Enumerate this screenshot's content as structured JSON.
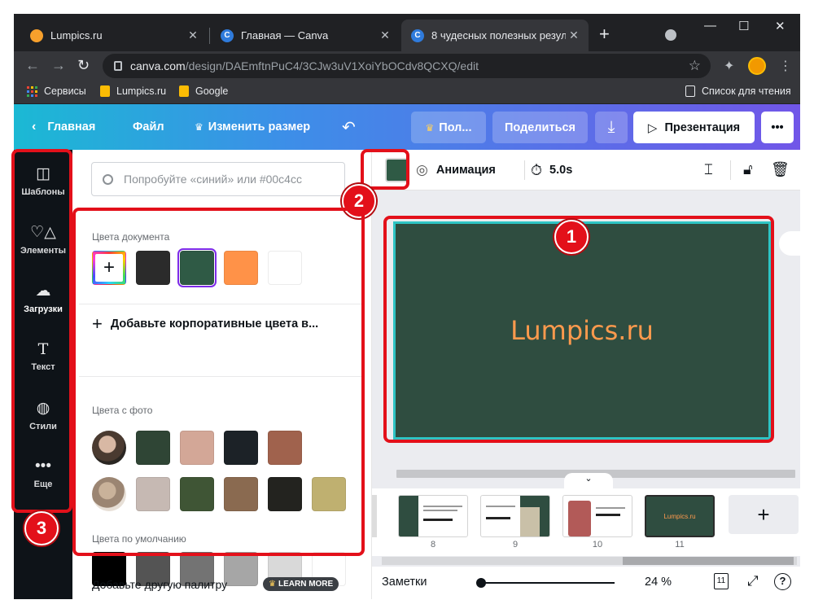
{
  "browser": {
    "tabs": [
      {
        "title": "Lumpics.ru",
        "favicon_color": "#f7a02c"
      },
      {
        "title": "Главная — Canva",
        "favicon_color": "#2f7bdc"
      },
      {
        "title": "8 чудесных полезных результа",
        "favicon_color": "#2f7bdc"
      }
    ],
    "url_host": "canva.com",
    "url_path": "/design/DAEmftnPuC4/3CJw3uV1XoiYbOCdv8QCXQ/edit",
    "bookmarks": {
      "apps": "Сервисы",
      "items": [
        "Lumpics.ru",
        "Google"
      ],
      "reading_list": "Список для чтения"
    }
  },
  "canva": {
    "header": {
      "home": "Главная",
      "file": "Файл",
      "resize": "Изменить размер",
      "upgrade": "Пол...",
      "share": "Поделиться",
      "present": "Презентация",
      "more": "•••"
    },
    "rail": [
      {
        "label": "Шаблоны",
        "icon": "templates-icon"
      },
      {
        "label": "Элементы",
        "icon": "elements-icon"
      },
      {
        "label": "Загрузки",
        "icon": "uploads-icon"
      },
      {
        "label": "Текст",
        "icon": "text-icon"
      },
      {
        "label": "Стили",
        "icon": "styles-icon"
      },
      {
        "label": "Еще",
        "icon": "more-icon"
      }
    ],
    "panel": {
      "search_placeholder": "Попробуйте «синий» или #00c4cc",
      "document_colors_label": "Цвета документа",
      "document_colors": [
        "#2b2b2b",
        "#2f5a45",
        "#ff9248",
        "#ffffff"
      ],
      "selected_color": "#2f5a45",
      "add_brand": "Добавьте корпоративные цвета в...",
      "photo_colors_label": "Цвета с фото",
      "photo_row_1": [
        "#2f4535",
        "#d3a797",
        "#1c2227",
        "#a0624d"
      ],
      "photo_row_2": [
        "#c6b9b3",
        "#3f5535",
        "#8a6a50",
        "#23231f",
        "#bfb070"
      ],
      "default_colors_label": "Цвета по умолчанию",
      "default_colors": [
        "#000000",
        "#545454",
        "#737373",
        "#a6a6a6",
        "#d9d9d9",
        "#ffffff"
      ],
      "footer_text": "Добавьте другую палитру",
      "learn_more": "LEARN MORE"
    },
    "toolbar": {
      "animation": "Анимация",
      "duration": "5.0s"
    },
    "slide": {
      "text": "Lumpics.ru",
      "background": "#2f4d40",
      "text_color": "#ff9a4d"
    },
    "pages": [
      {
        "num": "8"
      },
      {
        "num": "9"
      },
      {
        "num": "10"
      },
      {
        "num": "11",
        "label": "Lumpics.ru"
      }
    ],
    "bottom": {
      "notes": "Заметки",
      "zoom": "24 %",
      "page_count": "11",
      "help": "?"
    }
  },
  "callouts": [
    "1",
    "2",
    "3"
  ]
}
